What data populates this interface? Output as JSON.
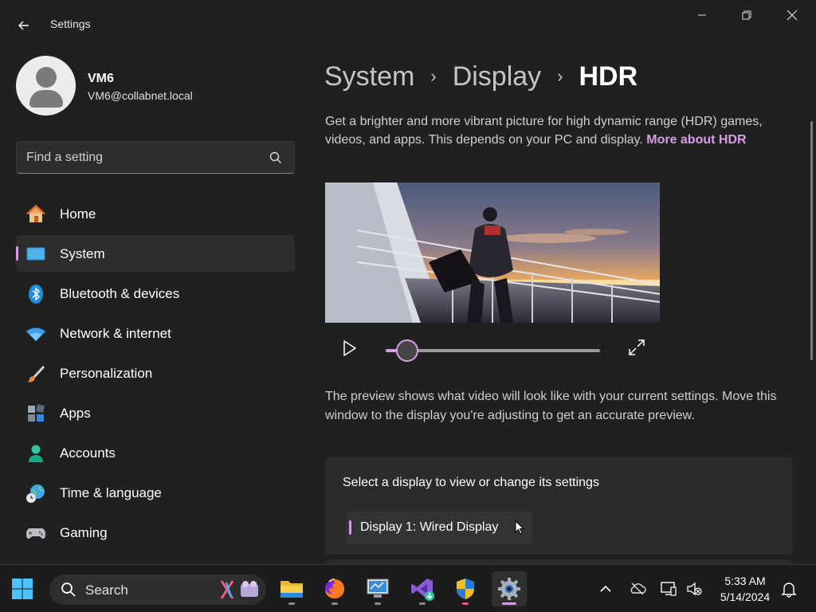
{
  "window": {
    "title": "Settings",
    "back_icon": "back-arrow-icon"
  },
  "profile": {
    "name": "VM6",
    "email": "VM6@collabnet.local"
  },
  "search": {
    "placeholder": "Find a setting"
  },
  "sidebar": {
    "items": [
      {
        "label": "Home",
        "icon": "home-icon",
        "selected": false
      },
      {
        "label": "System",
        "icon": "system-icon",
        "selected": true
      },
      {
        "label": "Bluetooth & devices",
        "icon": "bluetooth-icon",
        "selected": false
      },
      {
        "label": "Network & internet",
        "icon": "wifi-icon",
        "selected": false
      },
      {
        "label": "Personalization",
        "icon": "brush-icon",
        "selected": false
      },
      {
        "label": "Apps",
        "icon": "apps-icon",
        "selected": false
      },
      {
        "label": "Accounts",
        "icon": "accounts-icon",
        "selected": false
      },
      {
        "label": "Time & language",
        "icon": "globe-clock-icon",
        "selected": false
      },
      {
        "label": "Gaming",
        "icon": "gamepad-icon",
        "selected": false
      }
    ]
  },
  "breadcrumb": {
    "items": [
      "System",
      "Display"
    ],
    "current": "HDR",
    "separator": "›"
  },
  "main": {
    "description": "Get a brighter and more vibrant picture for high dynamic range (HDR) games, videos, and apps. This depends on your PC and display.",
    "learn_more": "More about HDR",
    "player": {
      "progress": 0.1
    },
    "preview_note": "The preview shows what video will look like with your current settings. Move this window to the display you're adjusting to get an accurate preview.",
    "display_select_label": "Select a display to view or change its settings",
    "display_selected": "Display 1: Wired Display"
  },
  "taskbar": {
    "search_label": "Search",
    "apps": [
      "file-explorer-icon",
      "firefox-icon",
      "remote-desktop-icon",
      "visual-studio-installer-icon",
      "security-shield-icon",
      "settings-gear-icon"
    ],
    "tray": [
      "chevron-up-icon",
      "onedrive-icon",
      "network-icon",
      "volume-muted-icon"
    ],
    "time": "5:33 AM",
    "date": "5/14/2024",
    "notification_icon": "bell-icon"
  },
  "colors": {
    "accent": "#d69ee8",
    "background": "#202020",
    "card": "#2b2b2b"
  }
}
